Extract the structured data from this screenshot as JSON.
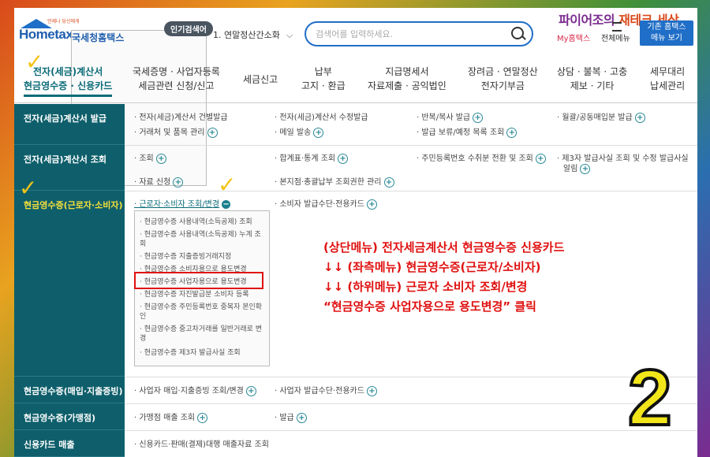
{
  "header": {
    "logo_brand": "Hometax.",
    "logo_sub": "국세청홈택스",
    "logo_tiny": "언제나 당신에게",
    "popular_label": "인기검색어",
    "popular_item": "1. 연말정산간소화",
    "search_placeholder": "검색어를 입력하세요.",
    "blog_title_a": "파이어조의",
    "blog_title_b": " 재테크 세상",
    "my_hometax": "My홈택스",
    "all_menu": "전체메뉴",
    "old_view": "기존 홈택스\n메뉴 보기"
  },
  "top_nav": [
    {
      "label": "전자(세금)계산서\n현금영수증 · 신용카드"
    },
    {
      "label": "국세증명 · 사업자등록\n세금관련 신청/신고"
    },
    {
      "label": "세금신고"
    },
    {
      "label": "납부\n고지 · 환급"
    },
    {
      "label": "지급명세서\n자료제출 · 공익법인"
    },
    {
      "label": "장려금 · 연말정산\n전자기부금"
    },
    {
      "label": "상담 · 불복 · 고충\n제보 · 기타"
    },
    {
      "label": "세무대리\n납세관리"
    }
  ],
  "sections": [
    {
      "label": "전자(세금)계산서 발급",
      "items": [
        "· 전자(세금)계산서 건별발급",
        "· 전자(세금)계산서 수정발급",
        "· 반복/복사 발급",
        "· 월괄/공동매입분 발급",
        "· 거래처 및 품목 관리",
        "· 메일 발송",
        "· 발급 보류/예정 목록 조회"
      ]
    },
    {
      "label": "전자(세금)계산서 조회",
      "items": [
        "· 조회",
        "· 합계표·통계 조회",
        "· 주민등록번호 수취분 전환 및 조회",
        "· 제3자 발급사실 조회 및 수정 발급사실",
        "알림",
        "· 자료 신청",
        "· 본지점·총괄납부 조회권한 관리"
      ]
    },
    {
      "label": "현금영수증(근로자·소비자)",
      "items": [
        "· 근로자·소비자 조회/변경",
        "· 소비자 발급수단·전용카드"
      ]
    },
    {
      "label": "현금영수증(매입·지출증빙)",
      "items": [
        "· 사업자 매입·지출증빙 조회/변경",
        "· 사업자 발급수단·전용카드"
      ]
    },
    {
      "label": "현금영수증(가맹점)",
      "items": [
        "· 가맹점 매출 조회",
        "· 발급"
      ]
    },
    {
      "label": "신용카드 매출",
      "items": [
        "· 신용카드·판매(결제)대행 매출자료 조회"
      ]
    }
  ],
  "submenu": [
    "· 현금영수증 사용내역(소득공제) 조회",
    "· 현금영수증 사용내역(소득공제) 누계 조회",
    "· 현금영수증 지출증빙거래지정",
    "· 현금영수증 소비자용으로 용도변경",
    "· 현금영수증 사업자용으로 용도변경",
    "· 현금영수증 자진발급분 소비자 등록",
    "· 현금영수증 주민등록번호 중복자 본인확인",
    "· 현금영수증 중고차거래를 일반거래로 변경",
    "· 현금영수증 제3자 발급사실 조회"
  ],
  "annotation": [
    "(상단메뉴) 전자세금계산서 현금영수증 신용카드",
    "↓↓ (좌측메뉴) 현금영수증(근로자/소비자)",
    "↓↓ (하위메뉴) 근로자 소비자 조회/변경",
    "“현금영수증 사업자용으로 용도변경” 클릭"
  ],
  "step_number": "2",
  "colors": {
    "left_column": "#0e5f6b",
    "highlight": "#f5e03a",
    "annotation": "#e01010",
    "accent": "#1f6ec7"
  }
}
